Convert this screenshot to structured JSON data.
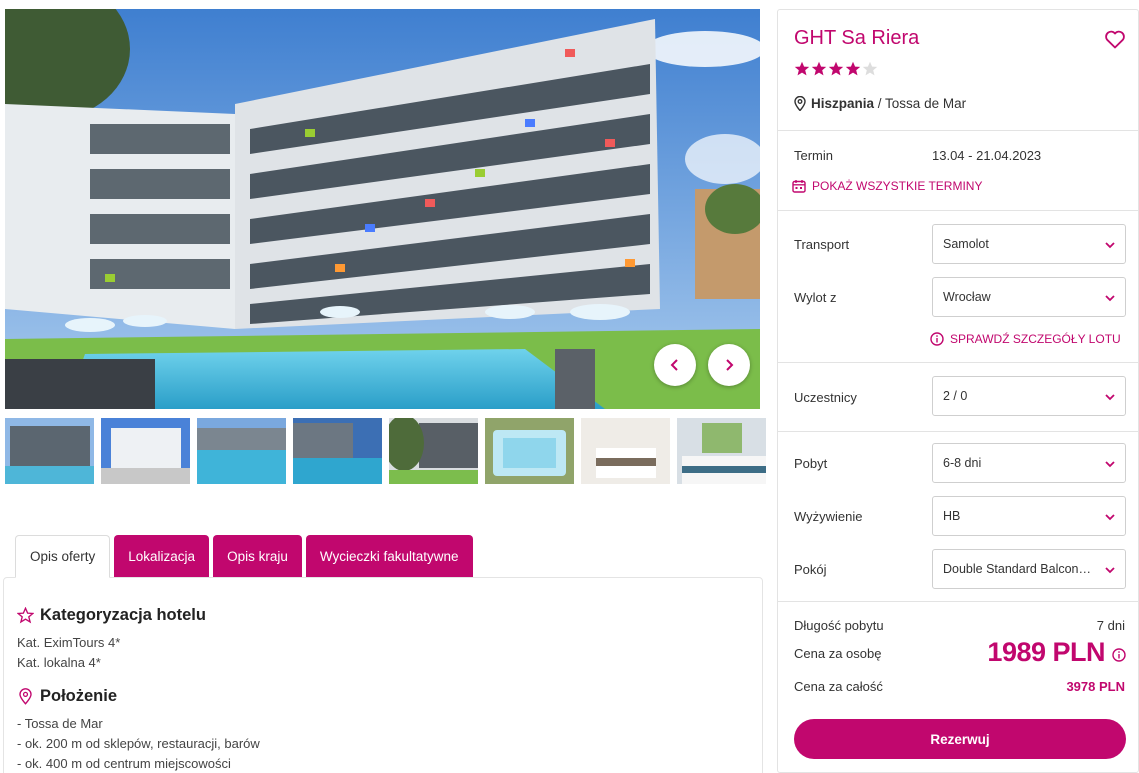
{
  "gallery": {
    "prev_label": "previous",
    "next_label": "next",
    "thumbnails": [
      "pool-building",
      "building-front",
      "pool-ladder",
      "pool-evening",
      "pool-trees",
      "jacuzzi",
      "bedroom-1",
      "bedroom-2"
    ]
  },
  "tabs": [
    {
      "label": "Opis oferty",
      "active": true
    },
    {
      "label": "Lokalizacja",
      "active": false
    },
    {
      "label": "Opis kraju",
      "active": false
    },
    {
      "label": "Wycieczki fakultatywne",
      "active": false
    }
  ],
  "description": {
    "category_title": "Kategoryzacja hotelu",
    "category_lines": [
      "Kat. EximTours 4*",
      "Kat. lokalna 4*"
    ],
    "location_title": "Położenie",
    "location_lines": [
      "- Tossa de Mar",
      "- ok. 200 m od sklepów, restauracji, barów",
      "- ok. 400 m od centrum miejscowości"
    ]
  },
  "hotel": {
    "name": "GHT Sa Riera",
    "stars": 4,
    "max_stars": 5,
    "country": "Hiszpania",
    "separator": " / ",
    "city": "Tossa de Mar"
  },
  "term": {
    "label": "Termin",
    "value": "13.04 - 21.04.2023",
    "all_terms_link": "POKAŻ WSZYSTKIE TERMINY"
  },
  "options": {
    "transport_label": "Transport",
    "transport_value": "Samolot",
    "departure_label": "Wylot z",
    "departure_value": "Wrocław",
    "flight_link": "SPRAWDŹ SZCZEGÓŁY LOTU",
    "participants_label": "Uczestnicy",
    "participants_value": "2 / 0",
    "stay_label": "Pobyt",
    "stay_value": "6-8 dni",
    "board_label": "Wyżywienie",
    "board_value": "HB",
    "room_label": "Pokój",
    "room_value": "Double Standard Balcony or T..."
  },
  "summary": {
    "length_label": "Długość pobytu",
    "length_value": "7 dni",
    "per_person_label": "Cena za osobę",
    "per_person_value": "1989 PLN",
    "total_label": "Cena za całość",
    "total_value": "3978 PLN",
    "reserve_label": "Rezerwuj"
  },
  "colors": {
    "accent": "#c1076e",
    "star_empty": "#dddddd",
    "border": "#e3e3e3"
  }
}
